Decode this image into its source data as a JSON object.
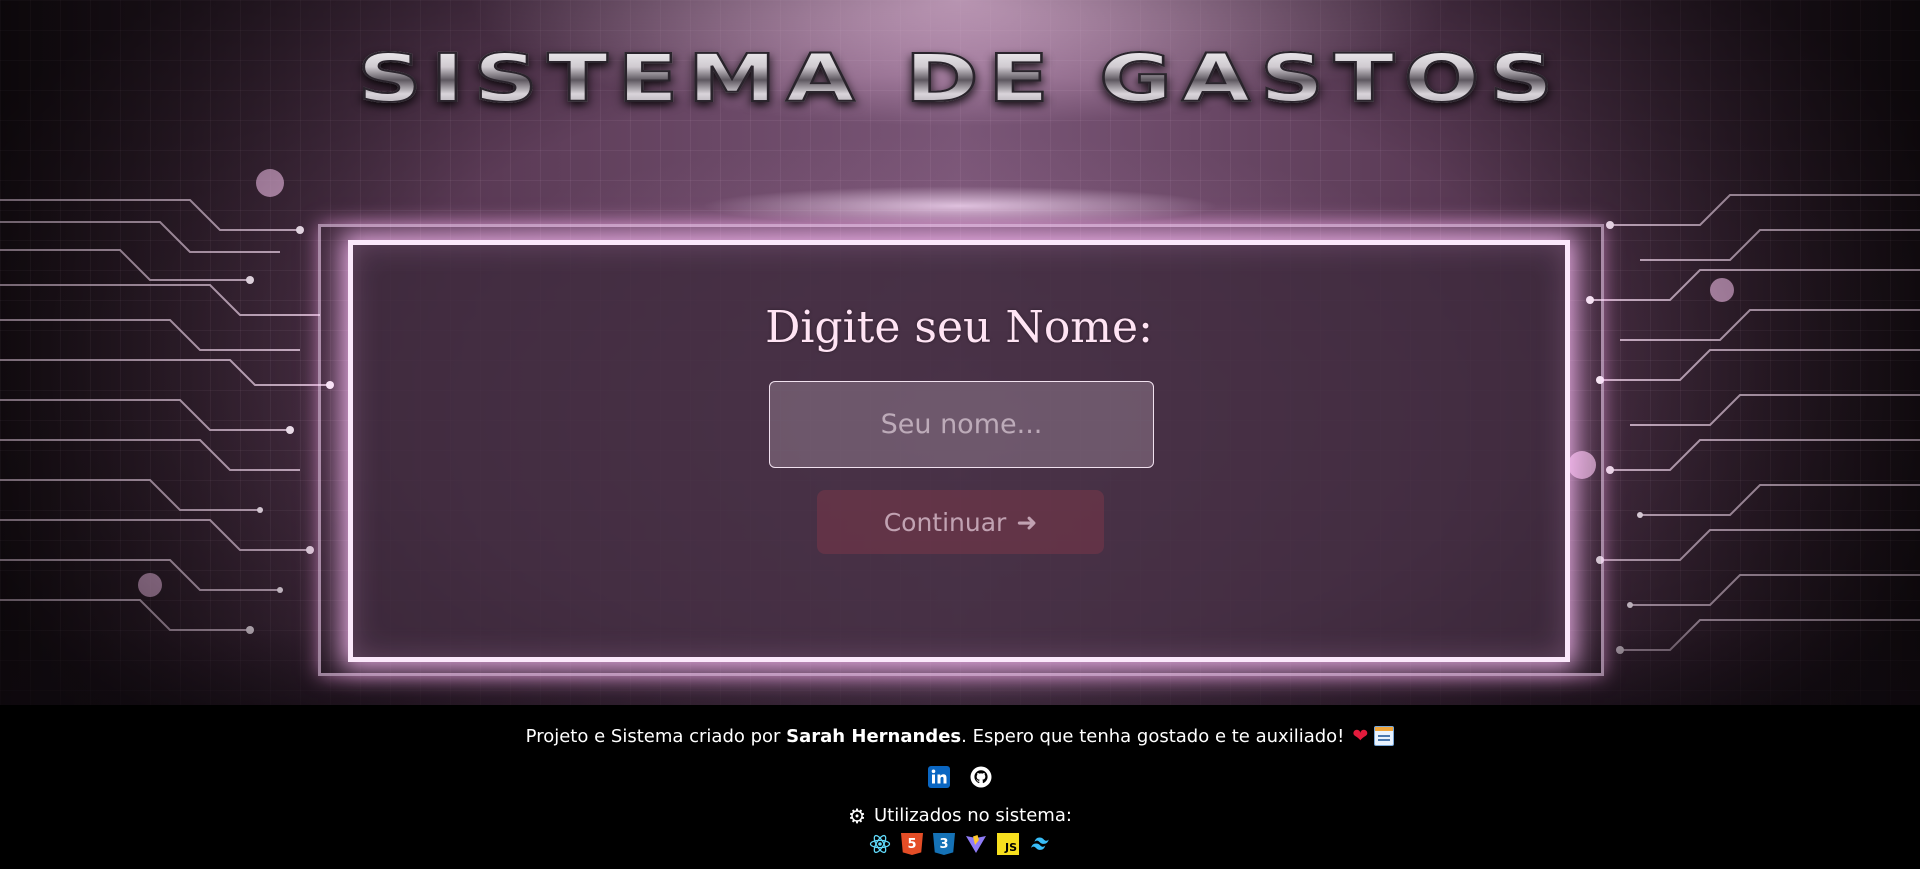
{
  "header": {
    "title": "SISTEMA DE GASTOS"
  },
  "form": {
    "prompt": "Digite seu Nome:",
    "name_placeholder": "Seu nome...",
    "continue_label": "Continuar",
    "continue_arrow": "➜"
  },
  "footer": {
    "credit_prefix": "Projeto e Sistema criado por ",
    "author": "Sarah Hernandes",
    "credit_suffix": ". Espero que tenha gostado e te auxiliado!",
    "heart": "❤",
    "social": [
      "linkedin-icon",
      "github-icon"
    ],
    "used_label": "Utilizados no sistema:",
    "used_icon": "⚙",
    "technologies": [
      "react-icon",
      "html5-icon",
      "css3-icon",
      "vite-icon",
      "javascript-icon",
      "tailwind-icon"
    ]
  },
  "colors": {
    "accent_glow": "#ffbefa",
    "card_bg": "#3e2a3c",
    "button_bg": "#783648",
    "footer_bg": "#000000",
    "linkedin": "#0a66c2",
    "heart": "#e21b3c"
  }
}
